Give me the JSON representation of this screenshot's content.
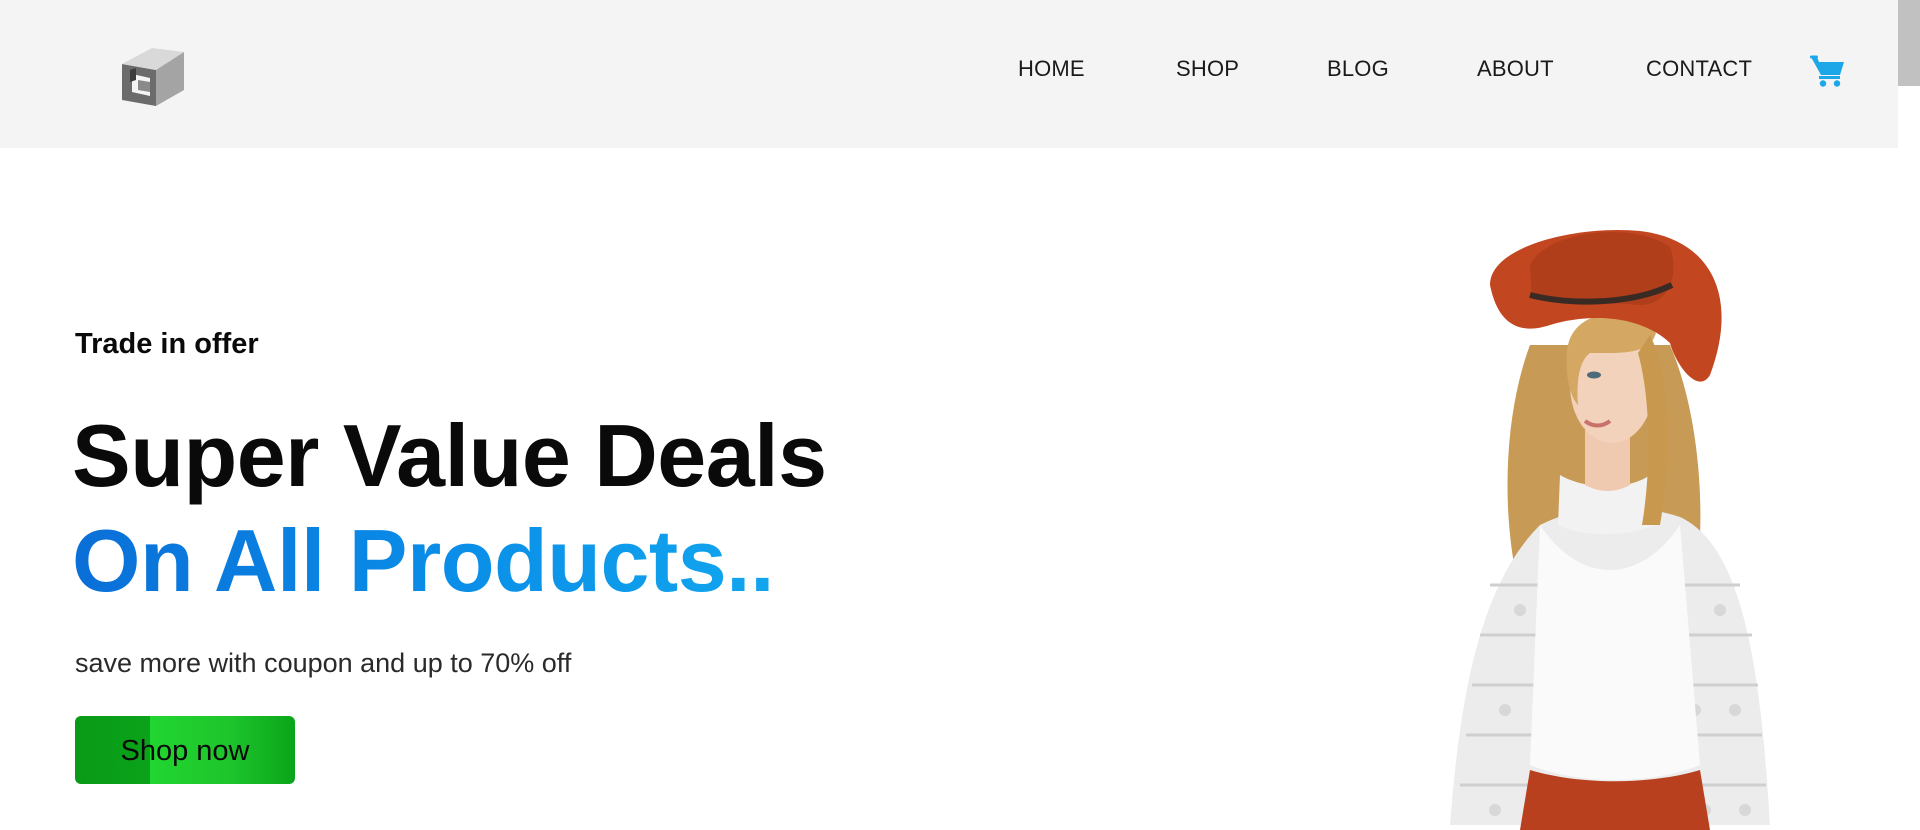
{
  "header": {
    "nav": {
      "home": "HOME",
      "shop": "SHOP",
      "blog": "BLOG",
      "about": "ABOUT",
      "contact": "CONTACT"
    },
    "cart_icon": "shopping-cart-icon",
    "logo_icon": "cube-logo-icon"
  },
  "hero": {
    "kicker": "Trade in offer",
    "title_line1": "Super Value Deals",
    "title_line2": "On All Products..",
    "subtitle": "save more with coupon and up to 70% off",
    "cta_label": "Shop now",
    "image": "woman-red-hat-white-lace-blouse"
  },
  "colors": {
    "header_bg": "#f4f4f4",
    "accent_blue": "#0a8ee8",
    "cart_blue": "#1ea7e8",
    "cta_green": "#0aa31a",
    "cta_green_light": "#21d630",
    "hat_red": "#c2461f"
  }
}
